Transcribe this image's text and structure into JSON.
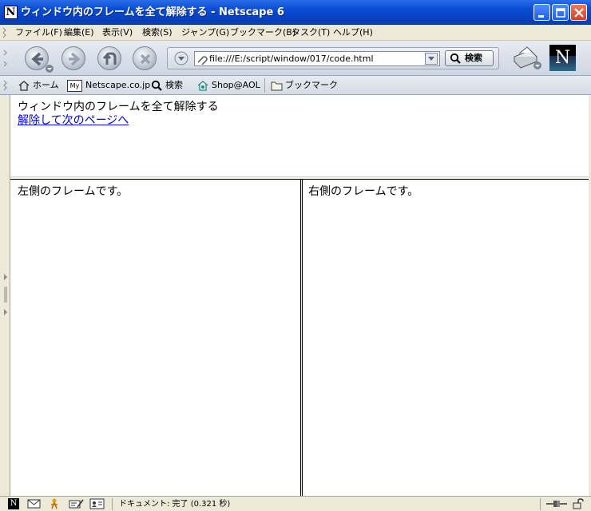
{
  "window": {
    "title": "ウィンドウ内のフレームを全て解除する - Netscape 6",
    "app_icon_letter": "N"
  },
  "menubar": {
    "items": [
      {
        "label": "ファイル(F)"
      },
      {
        "label": "編集(E)"
      },
      {
        "label": "表示(V)"
      },
      {
        "label": "検索(S)"
      },
      {
        "label": "ジャンプ(G)"
      },
      {
        "label": "ブックマーク(B)"
      },
      {
        "label": "タスク(T)"
      },
      {
        "label": "ヘルプ(H)"
      }
    ]
  },
  "navbar": {
    "url": "file:///E:/script/window/017/code.html",
    "search_label": "検索",
    "brand_letter": "N"
  },
  "personal_toolbar": {
    "items": [
      {
        "label": "ホーム",
        "icon": "home-icon"
      },
      {
        "label": "Netscape.co.jp",
        "icon": "my-netscape-icon",
        "icon_text": "My"
      },
      {
        "label": "検索",
        "icon": "search-icon"
      },
      {
        "label": "Shop@AOL",
        "icon": "shop-icon"
      },
      {
        "label": "ブックマーク",
        "icon": "folder-icon"
      }
    ]
  },
  "content": {
    "top_frame": {
      "heading": "ウィンドウ内のフレームを全て解除する",
      "link": "解除して次のページへ"
    },
    "left_frame": {
      "text": "左側のフレームです。"
    },
    "right_frame": {
      "text": "右側のフレームです。"
    }
  },
  "statusbar": {
    "text": "ドキュメント: 完了 (0.321 秒)"
  },
  "colors": {
    "titlebar": "#0a4fd6",
    "link": "#0000ee",
    "chrome": "#ece9d8"
  }
}
